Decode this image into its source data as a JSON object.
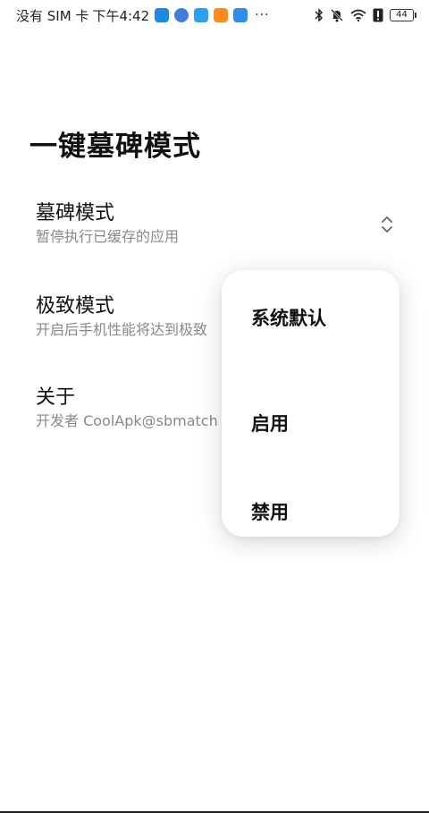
{
  "status_bar": {
    "carrier": "没有 SIM 卡",
    "time": "下午4:42",
    "overflow": "···",
    "battery": "44",
    "app_icon_colors": [
      "#1e88e5",
      "#3f7fd8",
      "#2aa1f0",
      "#ff8a1e",
      "#2f8fe8"
    ],
    "icons": [
      "bluetooth-icon",
      "mute-icon",
      "wifi-icon",
      "alert-icon",
      "battery-icon"
    ]
  },
  "page": {
    "title": "一键墓碑模式"
  },
  "settings": [
    {
      "title": "墓碑模式",
      "subtitle": "暂停执行已缓存的应用"
    },
    {
      "title": "极致模式",
      "subtitle": "开启后手机性能将达到极致"
    },
    {
      "title": "关于",
      "subtitle": "开发者 CoolApk@sbmatch"
    }
  ],
  "dropdown": {
    "options": [
      "系统默认",
      "启用",
      "禁用"
    ]
  }
}
